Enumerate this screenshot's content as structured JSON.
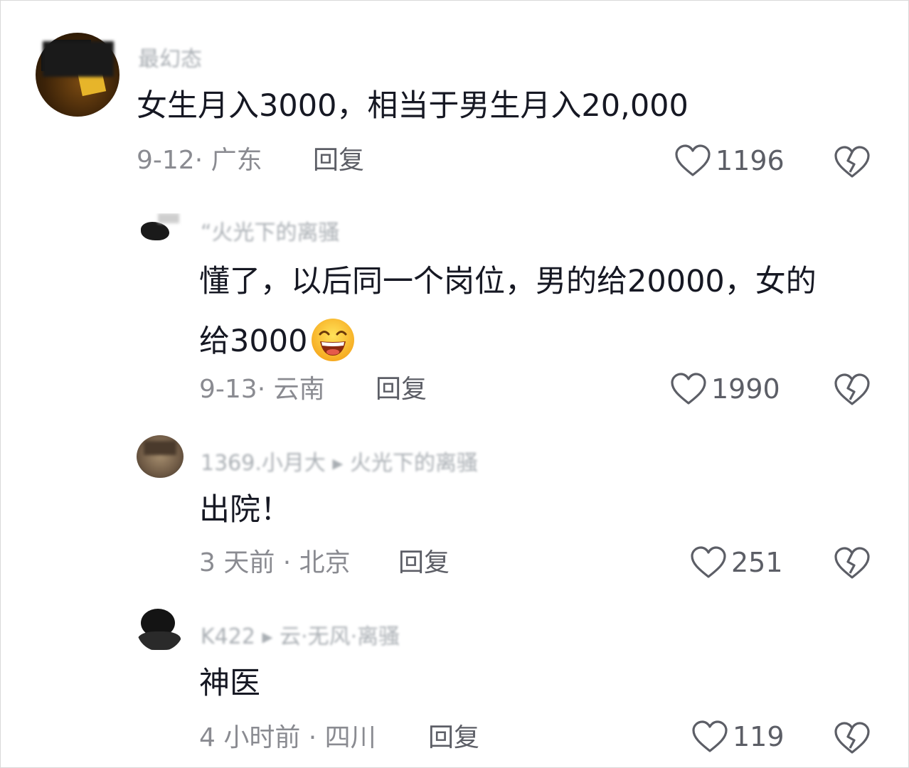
{
  "comments": [
    {
      "username": "最幻态",
      "text": "女生月入3000，相当于男生月入20,000",
      "date_location": "9-12· 广东",
      "reply_label": "回复",
      "likes": "1196"
    },
    {
      "username": "“火光下的离骚",
      "text_line1": "懂了，以后同一个岗位，男的给20000，女的",
      "text_line2": "给3000",
      "emoji": "grinning-face",
      "date_location": "9-13· 云南",
      "reply_label": "回复",
      "likes": "1990"
    },
    {
      "username": "1369.小月大 ▸ 火光下的离骚",
      "text": "出院！",
      "date_location": "3 天前 · 北京",
      "reply_label": "回复",
      "likes": "251"
    },
    {
      "username": "K422 ▸ 云·无风·离骚",
      "text": "神医",
      "date_location": "4 小时前 · 四川",
      "reply_label": "回复",
      "likes": "119"
    }
  ],
  "colors": {
    "text": "#161823",
    "meta": "#8a8b91",
    "icon": "#5c5e66"
  }
}
